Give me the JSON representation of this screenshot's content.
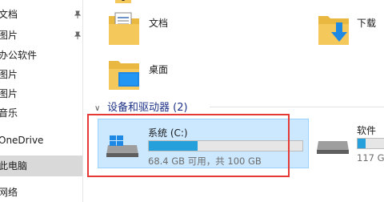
{
  "nav": {
    "items": [
      {
        "label": "文档",
        "pinned": true
      },
      {
        "label": "图片",
        "pinned": true
      },
      {
        "label": "办公软件",
        "pinned": false
      },
      {
        "label": "图片",
        "pinned": false
      },
      {
        "label": "图片",
        "pinned": false
      },
      {
        "label": "音乐",
        "pinned": false
      },
      {
        "label": "OneDrive",
        "pinned": false
      },
      {
        "label": "此电脑",
        "pinned": false
      },
      {
        "label": "网络",
        "pinned": false
      }
    ]
  },
  "folders": [
    {
      "name": "文档",
      "icon": "documents-folder-icon"
    },
    {
      "name": "下载",
      "icon": "downloads-folder-icon"
    },
    {
      "name": "桌面",
      "icon": "desktop-folder-icon"
    }
  ],
  "devices": {
    "header": "设备和驱动器 (2)",
    "drives": [
      {
        "name": "系统 (C:)",
        "free_text": "68.4 GB 可用，共 100 GB",
        "used_fraction": 0.316,
        "icon": "windows-drive-icon"
      },
      {
        "name": "软件",
        "free_text": "117 G",
        "used_fraction": 0.25,
        "icon": "hard-drive-icon"
      }
    ]
  },
  "colors": {
    "accent": "#26a0da",
    "selection": "#cce8ff",
    "annotation": "#e53935",
    "folder": "#f5c85b"
  }
}
